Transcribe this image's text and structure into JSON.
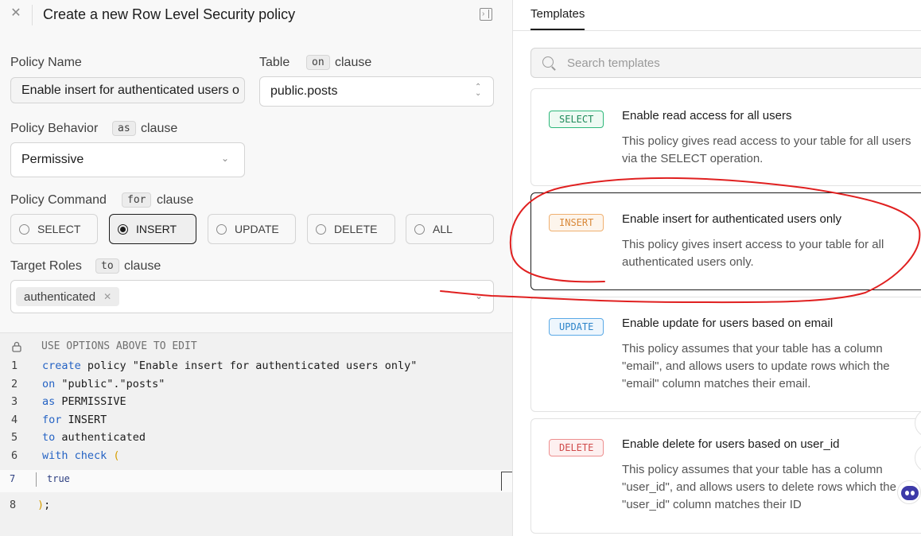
{
  "header": {
    "title": "Create a new Row Level Security policy"
  },
  "form": {
    "policy_name_label": "Policy Name",
    "policy_name_value": "Enable insert for authenticated users o",
    "table_label": "Table",
    "table_kbd": "on",
    "table_clause": "clause",
    "table_value": "public.posts",
    "behavior_label": "Policy Behavior",
    "behavior_kbd": "as",
    "behavior_clause": "clause",
    "behavior_value": "Permissive",
    "command_label": "Policy Command",
    "command_kbd": "for",
    "command_clause": "clause",
    "commands": [
      "SELECT",
      "INSERT",
      "UPDATE",
      "DELETE",
      "ALL"
    ],
    "selected_command": "INSERT",
    "roles_label": "Target Roles",
    "roles_kbd": "to",
    "roles_clause": "clause",
    "role_chip": "authenticated"
  },
  "editor": {
    "comment": "USE OPTIONS ABOVE TO EDIT",
    "line_numbers": [
      "1",
      "2",
      "3",
      "4",
      "5",
      "6",
      "7",
      "8"
    ],
    "l1_kw": "create",
    "l1_rest": " policy \"Enable insert for authenticated users only\"",
    "l2_kw": "on",
    "l2_rest": " \"public\".\"posts\"",
    "l3_kw": "as",
    "l3_rest": " PERMISSIVE",
    "l4_kw": "for",
    "l4_rest": " INSERT",
    "l5_kw": "to",
    "l5_rest": " authenticated",
    "l6_kw": "with check",
    "l6_paren": "(",
    "l7": "true",
    "l8_paren": ")",
    "l8_rest": ";"
  },
  "templates": {
    "tab_label": "Templates",
    "search_placeholder": "Search templates",
    "cards": [
      {
        "badge": "SELECT",
        "title": "Enable read access for all users",
        "desc": "This policy gives read access to your table for all users via the SELECT operation."
      },
      {
        "badge": "INSERT",
        "title": "Enable insert for authenticated users only",
        "desc": "This policy gives insert access to your table for all authenticated users only."
      },
      {
        "badge": "UPDATE",
        "title": "Enable update for users based on email",
        "desc": "This policy assumes that your table has a column \"email\", and allows users to update rows which the \"email\" column matches their email."
      },
      {
        "badge": "DELETE",
        "title": "Enable delete for users based on user_id",
        "desc": "This policy assumes that your table has a column \"user_id\", and allows users to delete rows which the \"user_id\" column matches their ID"
      }
    ]
  },
  "colors": {
    "annotation": "#e02020",
    "keyword": "#2563c4",
    "select_badge": "#1f8a5a",
    "insert_badge": "#d9893a",
    "update_badge": "#2c83c9",
    "delete_badge": "#d04a4a"
  }
}
